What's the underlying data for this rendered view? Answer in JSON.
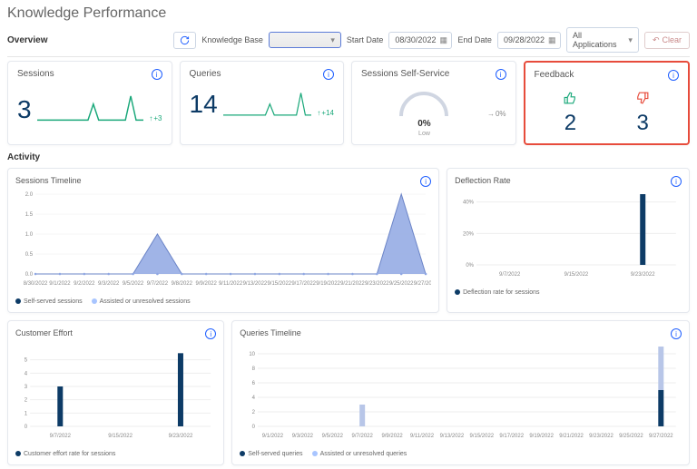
{
  "page": {
    "title": "Knowledge Performance"
  },
  "sections": {
    "overview": "Overview",
    "activity": "Activity"
  },
  "filters": {
    "kb_label": "Knowledge Base",
    "start_label": "Start Date",
    "start_value": "08/30/2022",
    "end_label": "End Date",
    "end_value": "09/28/2022",
    "apps_label": "All Applications",
    "clear_label": "Clear"
  },
  "kpi": {
    "sessions": {
      "title": "Sessions",
      "value": "3",
      "trend": "+3"
    },
    "queries": {
      "title": "Queries",
      "value": "14",
      "trend": "+14"
    },
    "selfservice": {
      "title": "Sessions Self-Service",
      "gauge_value": "0%",
      "gauge_sub": "Low",
      "trend": "0%"
    },
    "feedback": {
      "title": "Feedback",
      "up": "2",
      "down": "3"
    }
  },
  "panels": {
    "sessions_timeline": {
      "title": "Sessions Timeline",
      "legend_a": "Self-served sessions",
      "legend_b": "Assisted or unresolved sessions"
    },
    "deflection": {
      "title": "Deflection Rate",
      "legend": "Deflection rate for sessions"
    },
    "ceffort": {
      "title": "Customer Effort",
      "legend": "Customer effort rate for sessions"
    },
    "qtimeline": {
      "title": "Queries Timeline",
      "legend_a": "Self-served queries",
      "legend_b": "Assisted or unresolved queries"
    }
  },
  "chart_data": [
    {
      "id": "sessions_timeline",
      "type": "area",
      "x": [
        "8/30/2022",
        "9/1/2022",
        "9/2/2022",
        "9/3/2022",
        "9/5/2022",
        "9/7/2022",
        "9/8/2022",
        "9/9/2022",
        "9/11/2022",
        "9/13/2022",
        "9/15/2022",
        "9/17/2022",
        "9/19/2022",
        "9/21/2022",
        "9/23/2022",
        "9/25/2022",
        "9/27/2022"
      ],
      "series": [
        {
          "name": "Self-served sessions",
          "values": [
            0,
            0,
            0,
            0,
            0,
            0,
            0,
            0,
            0,
            0,
            0,
            0,
            0,
            0,
            0,
            0,
            0
          ]
        },
        {
          "name": "Assisted or unresolved sessions",
          "values": [
            0,
            0,
            0,
            0,
            0,
            1,
            0,
            0,
            0,
            0,
            0,
            0,
            0,
            0,
            0,
            2,
            0
          ]
        }
      ],
      "ylim": [
        0,
        2
      ],
      "yticks": [
        0,
        0.5,
        1.0,
        1.5,
        2.0
      ]
    },
    {
      "id": "deflection_rate",
      "type": "bar",
      "categories": [
        "9/7/2022",
        "9/15/2022",
        "9/23/2022"
      ],
      "values": [
        0,
        0,
        45
      ],
      "ylim": [
        0,
        45
      ],
      "yticks": [
        0,
        20,
        40
      ],
      "ylabel_suffix": "%"
    },
    {
      "id": "customer_effort",
      "type": "bar",
      "categories": [
        "9/7/2022",
        "9/15/2022",
        "9/23/2022"
      ],
      "values": [
        3,
        0,
        5.5
      ],
      "ylim": [
        0,
        6
      ],
      "yticks": [
        0,
        1,
        2,
        3,
        4,
        5
      ]
    },
    {
      "id": "queries_timeline",
      "type": "bar-stacked",
      "categories": [
        "9/1/2022",
        "9/3/2022",
        "9/5/2022",
        "9/7/2022",
        "9/9/2022",
        "9/11/2022",
        "9/13/2022",
        "9/15/2022",
        "9/17/2022",
        "9/19/2022",
        "9/21/2022",
        "9/23/2022",
        "9/25/2022",
        "9/27/2022"
      ],
      "series": [
        {
          "name": "Self-served queries",
          "values": [
            0,
            0,
            0,
            0,
            0,
            0,
            0,
            0,
            0,
            0,
            0,
            0,
            0,
            5
          ]
        },
        {
          "name": "Assisted or unresolved queries",
          "values": [
            0,
            0,
            0,
            3,
            0,
            0,
            0,
            0,
            0,
            0,
            0,
            0,
            0,
            6
          ]
        }
      ],
      "ylim": [
        0,
        11
      ],
      "yticks": [
        0,
        2,
        4,
        6,
        8,
        10
      ]
    }
  ]
}
